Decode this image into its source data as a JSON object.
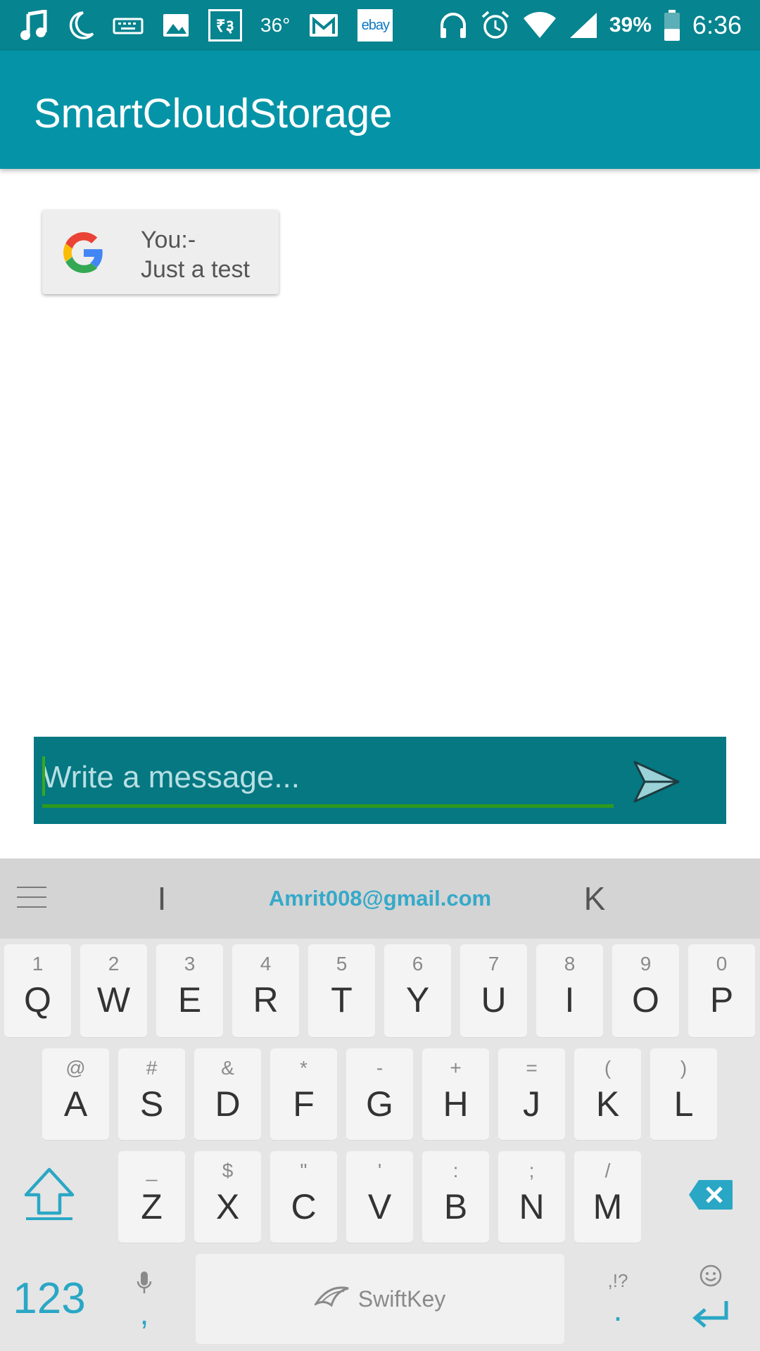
{
  "status_bar": {
    "temperature": "36°",
    "rupee_label": "₹३",
    "ebay_label": "ebay",
    "battery": "39%",
    "time": "6:36",
    "icons": [
      "music-note-icon",
      "moon-icon",
      "keyboard-icon",
      "image-icon",
      "rupee-icon",
      "gmail-icon",
      "ebay-icon",
      "headphones-icon",
      "alarm-icon",
      "wifi-icon",
      "signal-icon",
      "battery-icon"
    ]
  },
  "appbar": {
    "title": "SmartCloudStorage",
    "color": "#0594a7"
  },
  "chat": {
    "messages": [
      {
        "sender": "You:-",
        "text": "Just a test",
        "icon": "google-icon"
      }
    ]
  },
  "composer": {
    "placeholder": "Write a message...",
    "value": "",
    "send_icon": "send-icon",
    "color": "#057882"
  },
  "keyboard": {
    "suggestions": [
      "I",
      "Amrit008@gmail.com",
      "K"
    ],
    "row1": [
      {
        "sub": "1",
        "main": "Q"
      },
      {
        "sub": "2",
        "main": "W"
      },
      {
        "sub": "3",
        "main": "E"
      },
      {
        "sub": "4",
        "main": "R"
      },
      {
        "sub": "5",
        "main": "T"
      },
      {
        "sub": "6",
        "main": "Y"
      },
      {
        "sub": "7",
        "main": "U"
      },
      {
        "sub": "8",
        "main": "I"
      },
      {
        "sub": "9",
        "main": "O"
      },
      {
        "sub": "0",
        "main": "P"
      }
    ],
    "row2": [
      {
        "sub": "@",
        "main": "A"
      },
      {
        "sub": "#",
        "main": "S"
      },
      {
        "sub": "&",
        "main": "D"
      },
      {
        "sub": "*",
        "main": "F"
      },
      {
        "sub": "-",
        "main": "G"
      },
      {
        "sub": "+",
        "main": "H"
      },
      {
        "sub": "=",
        "main": "J"
      },
      {
        "sub": "(",
        "main": "K"
      },
      {
        "sub": ")",
        "main": "L"
      }
    ],
    "row3": [
      {
        "sub": "_",
        "main": "Z"
      },
      {
        "sub": "$",
        "main": "X"
      },
      {
        "sub": "\"",
        "main": "C"
      },
      {
        "sub": "'",
        "main": "V"
      },
      {
        "sub": ":",
        "main": "B"
      },
      {
        "sub": ";",
        "main": "N"
      },
      {
        "sub": "/",
        "main": "M"
      }
    ],
    "numbers_label": "123",
    "comma_label": ",",
    "period_label": ".",
    "punct_hint": ",!?",
    "space_brand": "SwiftKey",
    "accent": "#2aa7c5"
  }
}
